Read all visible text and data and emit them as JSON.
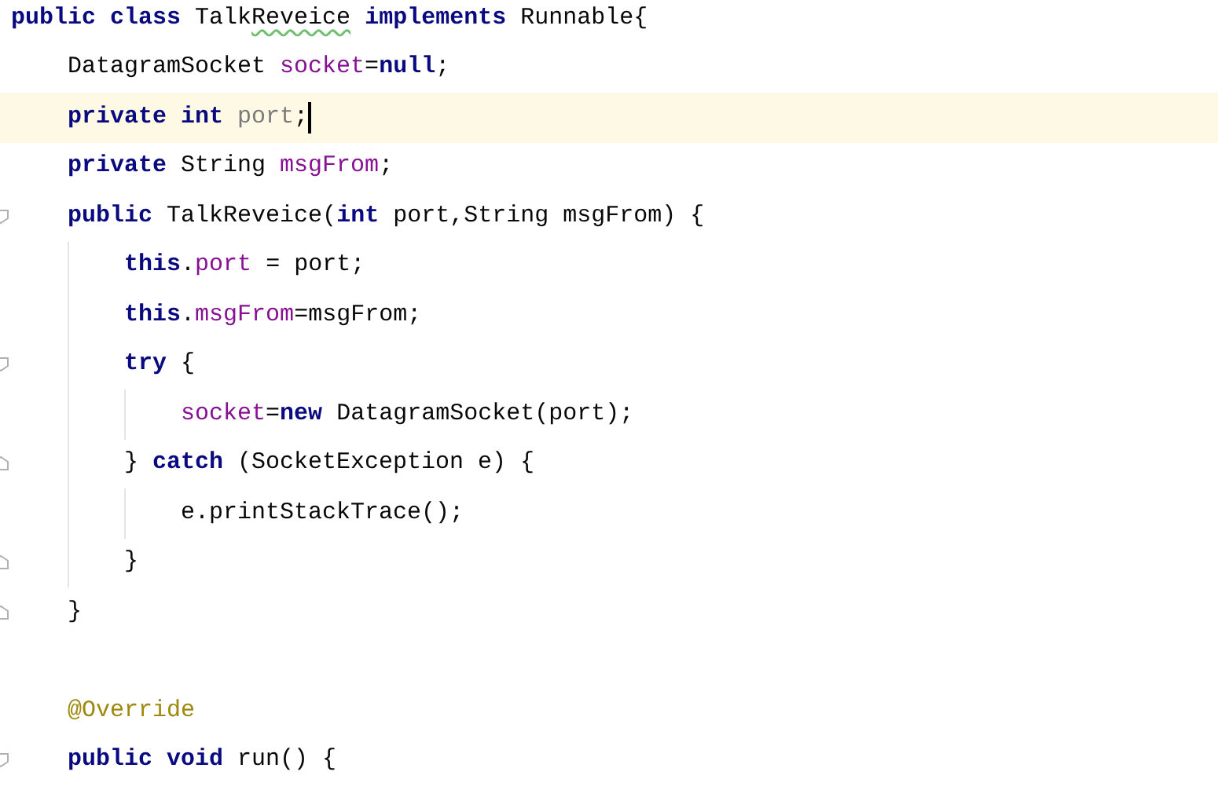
{
  "editor": {
    "lines": [
      {
        "kind": "code",
        "current": false,
        "fold_start": false,
        "fold_end": false,
        "tokens": [
          {
            "kind": "keyword",
            "text": "public class "
          },
          {
            "kind": "plain",
            "text": "Talk"
          },
          {
            "kind": "typo",
            "text": "Reveice"
          },
          {
            "kind": "keyword",
            "text": " implements "
          },
          {
            "kind": "plain",
            "text": "Runnable{"
          }
        ]
      },
      {
        "kind": "code",
        "current": false,
        "fold_start": false,
        "fold_end": false,
        "tokens": [
          {
            "kind": "plain",
            "text": "    DatagramSocket "
          },
          {
            "kind": "field",
            "text": "socket"
          },
          {
            "kind": "plain",
            "text": "="
          },
          {
            "kind": "keyword",
            "text": "null"
          },
          {
            "kind": "plain",
            "text": ";"
          }
        ]
      },
      {
        "kind": "code",
        "current": true,
        "fold_start": false,
        "fold_end": false,
        "tokens": [
          {
            "kind": "keyword",
            "text": "    private int "
          },
          {
            "kind": "unused",
            "text": "port"
          },
          {
            "kind": "plain",
            "text": ";"
          }
        ]
      },
      {
        "kind": "code",
        "current": false,
        "fold_start": false,
        "fold_end": false,
        "tokens": [
          {
            "kind": "keyword",
            "text": "    private "
          },
          {
            "kind": "plain",
            "text": "String "
          },
          {
            "kind": "field",
            "text": "msgFrom"
          },
          {
            "kind": "plain",
            "text": ";"
          }
        ]
      },
      {
        "kind": "code",
        "current": false,
        "fold_start": true,
        "fold_end": false,
        "tokens": [
          {
            "kind": "keyword",
            "text": "    public "
          },
          {
            "kind": "plain",
            "text": "TalkReveice("
          },
          {
            "kind": "keyword",
            "text": "int "
          },
          {
            "kind": "plain",
            "text": "port,String msgFrom) {"
          }
        ]
      },
      {
        "kind": "code",
        "current": false,
        "fold_start": false,
        "fold_end": false,
        "tokens": [
          {
            "kind": "keyword",
            "text": "        this"
          },
          {
            "kind": "plain",
            "text": "."
          },
          {
            "kind": "field",
            "text": "port"
          },
          {
            "kind": "plain",
            "text": " = port;"
          }
        ]
      },
      {
        "kind": "code",
        "current": false,
        "fold_start": false,
        "fold_end": false,
        "tokens": [
          {
            "kind": "keyword",
            "text": "        this"
          },
          {
            "kind": "plain",
            "text": "."
          },
          {
            "kind": "field",
            "text": "msgFrom"
          },
          {
            "kind": "plain",
            "text": "=msgFrom;"
          }
        ]
      },
      {
        "kind": "code",
        "current": false,
        "fold_start": true,
        "fold_end": false,
        "tokens": [
          {
            "kind": "keyword",
            "text": "        try "
          },
          {
            "kind": "plain",
            "text": "{"
          }
        ]
      },
      {
        "kind": "code",
        "current": false,
        "fold_start": false,
        "fold_end": false,
        "tokens": [
          {
            "kind": "field",
            "text": "            socket"
          },
          {
            "kind": "plain",
            "text": "="
          },
          {
            "kind": "keyword",
            "text": "new "
          },
          {
            "kind": "plain",
            "text": "DatagramSocket(port);"
          }
        ]
      },
      {
        "kind": "code",
        "current": false,
        "fold_start": false,
        "fold_end": true,
        "tokens": [
          {
            "kind": "plain",
            "text": "        } "
          },
          {
            "kind": "keyword",
            "text": "catch "
          },
          {
            "kind": "plain",
            "text": "(SocketException e) {"
          }
        ]
      },
      {
        "kind": "code",
        "current": false,
        "fold_start": false,
        "fold_end": false,
        "tokens": [
          {
            "kind": "plain",
            "text": "            e.printStackTrace();"
          }
        ]
      },
      {
        "kind": "code",
        "current": false,
        "fold_start": false,
        "fold_end": true,
        "tokens": [
          {
            "kind": "plain",
            "text": "        }"
          }
        ]
      },
      {
        "kind": "code",
        "current": false,
        "fold_start": false,
        "fold_end": true,
        "tokens": [
          {
            "kind": "plain",
            "text": "    }"
          }
        ]
      },
      {
        "kind": "blank"
      },
      {
        "kind": "code",
        "current": false,
        "fold_start": false,
        "fold_end": false,
        "tokens": [
          {
            "kind": "annotation",
            "text": "    @Override"
          }
        ]
      },
      {
        "kind": "code",
        "current": false,
        "fold_start": true,
        "fold_end": false,
        "tokens": [
          {
            "kind": "keyword",
            "text": "    public void "
          },
          {
            "kind": "plain",
            "text": "run() {"
          }
        ]
      }
    ]
  }
}
